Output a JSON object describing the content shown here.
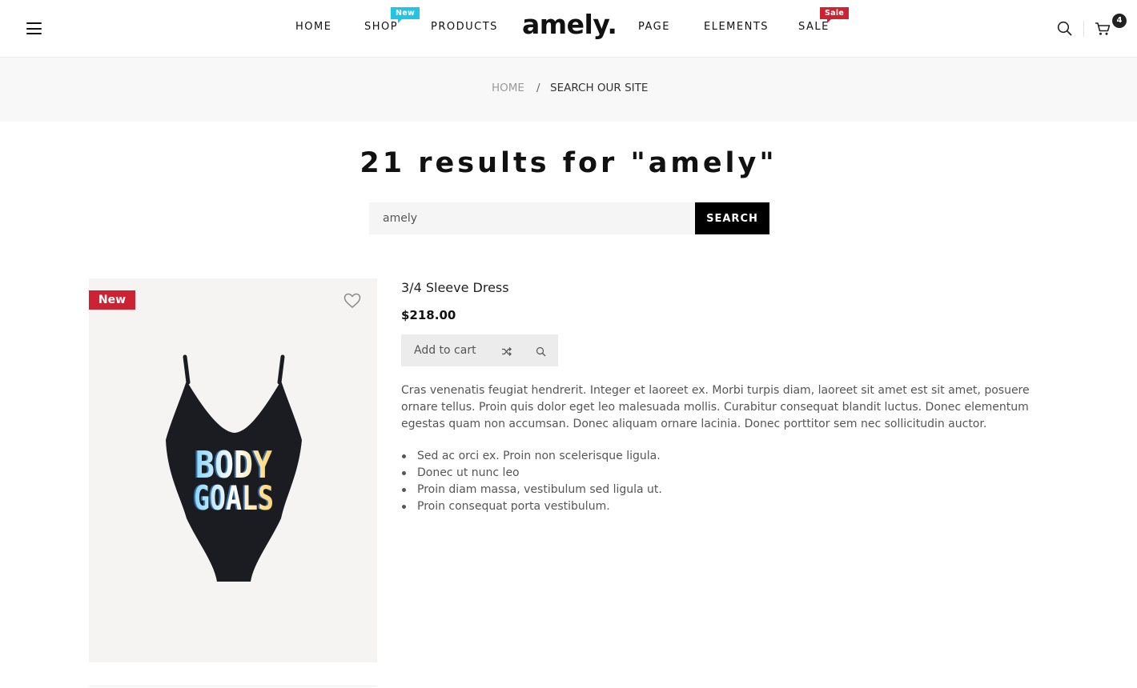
{
  "header": {
    "menu_icon": "hamburger-menu-icon",
    "nav": [
      {
        "label": "HOME"
      },
      {
        "label": "SHOP",
        "badge": "New"
      },
      {
        "label": "PRODUCTS"
      },
      {
        "label": "PAGE"
      },
      {
        "label": "ELEMENTS"
      },
      {
        "label": "SALE",
        "badge": "Sale"
      }
    ],
    "logo": "amely.",
    "search_icon": "search-icon",
    "cart_icon": "cart-icon",
    "cart_count": "4"
  },
  "breadcrumb": {
    "home": "HOME",
    "separator": "/",
    "current": "SEARCH OUR SITE"
  },
  "results": {
    "title": "21 results for \"amely\""
  },
  "search": {
    "value": "amely",
    "button_label": "SEARCH"
  },
  "product": {
    "badge": "New",
    "name": "3/4 Sleeve Dress",
    "price": "$218.00",
    "add_to_cart": "Add to cart",
    "image_print": "BODY GOALS",
    "description": "Cras venenatis feugiat hendrerit. Integer et laoreet ex. Morbi turpis diam, laoreet sit amet est sit amet, posuere ornare tellus. Proin quis dolor eget leo malesuada mollis. Curabitur consequat blandit luctus. Donec elementum egestas quam non accumsan. Donec aliquam ornare lacinia. Donec porttitor sem nec sollicitudin auctor.",
    "bullets": [
      "Sed ac orci ex. Proin non scelerisque ligula.",
      "Donec ut nunc leo",
      "Proin diam massa, vestibulum sed ligula ut.",
      "Proin consequat porta vestibulum."
    ]
  },
  "colors": {
    "accent_red": "#cc2233",
    "badge_new": "#1fc5e6",
    "dark": "#111111"
  }
}
